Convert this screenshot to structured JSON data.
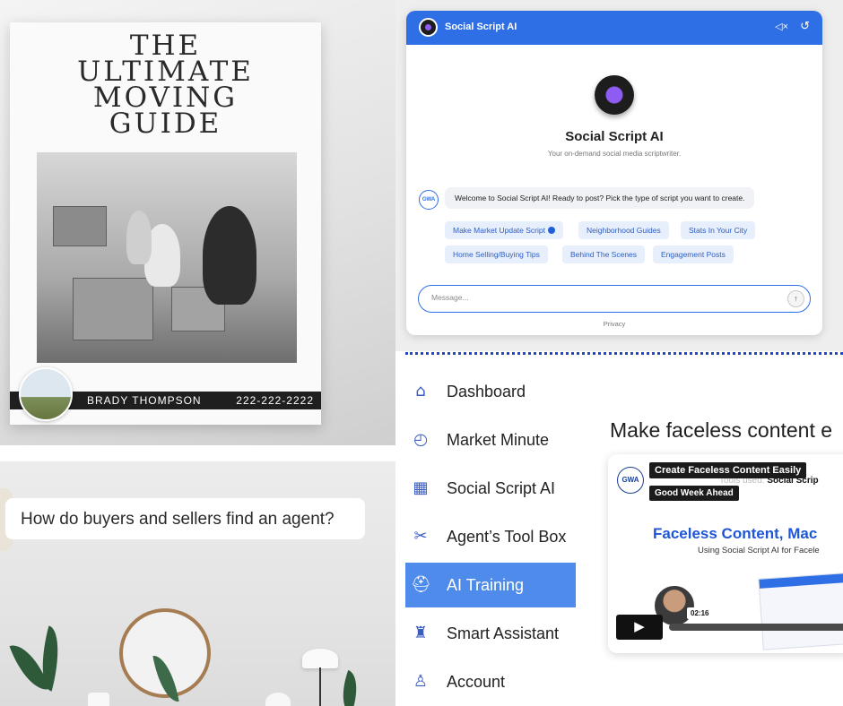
{
  "flyer": {
    "title": "THE ULTIMATE MOVING GUIDE",
    "agent_name": "BRADY THOMPSON",
    "phone": "222-222-2222"
  },
  "chat": {
    "header_title": "Social Script AI",
    "assistant_name": "Social Script AI",
    "tagline": "Your on-demand social media scriptwriter.",
    "bot_avatar_text": "GWA",
    "welcome_message": "Welcome to Social Script AI! Ready to post? Pick the type of script you want to create.",
    "chips": [
      "Make Market Update Script",
      "Neighborhood Guides",
      "Stats In Your City",
      "Home Selling/Buying Tips",
      "Behind The Scenes",
      "Engagement Posts"
    ],
    "message_placeholder": "Message...",
    "send_icon": "↑",
    "privacy_label": "Privacy",
    "accent_color": "#2e6fe5"
  },
  "question_scene": {
    "question": "How do buyers and sellers find an agent?"
  },
  "sidebar": {
    "items": [
      {
        "label": "Dashboard",
        "icon": "home-icon",
        "glyph": "⌂"
      },
      {
        "label": "Market Minute",
        "icon": "clock-icon",
        "glyph": "◴"
      },
      {
        "label": "Social Script AI",
        "icon": "film-icon",
        "glyph": "▦"
      },
      {
        "label": "Agent’s Tool Box",
        "icon": "tools-icon",
        "glyph": "✂"
      },
      {
        "label": "AI Training",
        "icon": "hardhat-icon",
        "glyph": "⛑"
      },
      {
        "label": "Smart Assistant",
        "icon": "robot-icon",
        "glyph": "♜"
      },
      {
        "label": "Account",
        "icon": "user-icon",
        "glyph": "♙"
      }
    ],
    "active_item": "AI Training",
    "active_color": "#4f8bea"
  },
  "content": {
    "heading": "Make faceless content e",
    "video": {
      "channel_logo_text": "GWA",
      "title": "Create Faceless Content Easily",
      "channel": "Good Week Ahead",
      "tools_used_prefix": "Tools used:",
      "tools_used_value": "Social Scrip",
      "headline": "Faceless Content, Mac",
      "subline": "Using Social Script AI for Facele",
      "duration": "02:16",
      "play_icon": "▶"
    }
  }
}
